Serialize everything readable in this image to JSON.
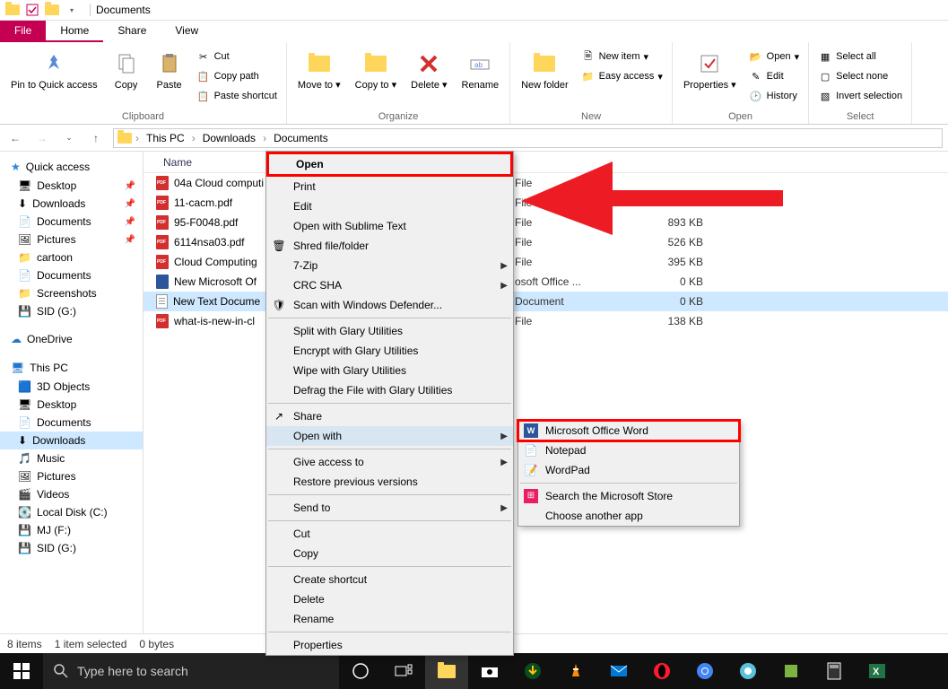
{
  "titlebar": {
    "title": "Documents"
  },
  "tabs": {
    "file": "File",
    "home": "Home",
    "share": "Share",
    "view": "View"
  },
  "ribbon": {
    "clipboard": {
      "label": "Clipboard",
      "pin": "Pin to Quick access",
      "copy": "Copy",
      "paste": "Paste",
      "cut": "Cut",
      "copy_path": "Copy path",
      "paste_shortcut": "Paste shortcut"
    },
    "organize": {
      "label": "Organize",
      "move_to": "Move to",
      "copy_to": "Copy to",
      "delete": "Delete",
      "rename": "Rename"
    },
    "new": {
      "label": "New",
      "new_folder": "New folder",
      "new_item": "New item",
      "easy_access": "Easy access"
    },
    "open": {
      "label": "Open",
      "properties": "Properties",
      "open": "Open",
      "edit": "Edit",
      "history": "History"
    },
    "select": {
      "label": "Select",
      "select_all": "Select all",
      "select_none": "Select none",
      "invert": "Invert selection"
    }
  },
  "breadcrumbs": [
    "This PC",
    "Downloads",
    "Documents"
  ],
  "sidebar": {
    "quick_access": "Quick access",
    "quick_items": [
      {
        "label": "Desktop",
        "pinned": true
      },
      {
        "label": "Downloads",
        "pinned": true
      },
      {
        "label": "Documents",
        "pinned": true
      },
      {
        "label": "Pictures",
        "pinned": true
      },
      {
        "label": "cartoon",
        "pinned": false
      },
      {
        "label": "Documents",
        "pinned": false
      },
      {
        "label": "Screenshots",
        "pinned": false
      },
      {
        "label": "SID (G:)",
        "pinned": false
      }
    ],
    "onedrive": "OneDrive",
    "this_pc": "This PC",
    "pc_items": [
      "3D Objects",
      "Desktop",
      "Documents",
      "Downloads",
      "Music",
      "Pictures",
      "Videos",
      "Local Disk (C:)",
      "MJ (F:)",
      "SID (G:)"
    ]
  },
  "columns": {
    "name": "Name",
    "type": "",
    "size": ""
  },
  "files": [
    {
      "name": "04a Cloud computi",
      "type": "File",
      "size": "",
      "icon": "pdf"
    },
    {
      "name": "11-cacm.pdf",
      "type": "File",
      "size": "",
      "icon": "pdf"
    },
    {
      "name": "95-F0048.pdf",
      "type": "File",
      "size": "893 KB",
      "icon": "pdf"
    },
    {
      "name": "6114nsa03.pdf",
      "type": "File",
      "size": "526 KB",
      "icon": "pdf"
    },
    {
      "name": "Cloud Computing",
      "type": "File",
      "size": "395 KB",
      "icon": "pdf"
    },
    {
      "name": "New Microsoft Of",
      "type": "osoft Office ...",
      "size": "0 KB",
      "icon": "doc"
    },
    {
      "name": "New Text Docume",
      "type": "Document",
      "size": "0 KB",
      "icon": "txt",
      "selected": true
    },
    {
      "name": "what-is-new-in-cl",
      "type": "File",
      "size": "138 KB",
      "icon": "pdf"
    }
  ],
  "status": {
    "items": "8 items",
    "selected": "1 item selected",
    "bytes": "0 bytes"
  },
  "context_menu": [
    {
      "label": "Open",
      "bold": true,
      "highlight": true
    },
    {
      "label": "Print"
    },
    {
      "label": "Edit"
    },
    {
      "label": "Open with Sublime Text"
    },
    {
      "label": "Shred file/folder",
      "icon": "shred"
    },
    {
      "label": "7-Zip",
      "sub": true
    },
    {
      "label": "CRC SHA",
      "sub": true
    },
    {
      "label": "Scan with Windows Defender...",
      "icon": "defender"
    },
    {
      "sep": true
    },
    {
      "label": "Split with Glary Utilities"
    },
    {
      "label": "Encrypt with Glary Utilities"
    },
    {
      "label": "Wipe with Glary Utilities"
    },
    {
      "label": "Defrag the File with Glary Utilities"
    },
    {
      "sep": true
    },
    {
      "label": "Share",
      "icon": "share"
    },
    {
      "label": "Open with",
      "sub": true,
      "hover": true
    },
    {
      "sep": true
    },
    {
      "label": "Give access to",
      "sub": true
    },
    {
      "label": "Restore previous versions"
    },
    {
      "sep": true
    },
    {
      "label": "Send to",
      "sub": true
    },
    {
      "sep": true
    },
    {
      "label": "Cut"
    },
    {
      "label": "Copy"
    },
    {
      "sep": true
    },
    {
      "label": "Create shortcut"
    },
    {
      "label": "Delete"
    },
    {
      "label": "Rename"
    },
    {
      "sep": true
    },
    {
      "label": "Properties"
    }
  ],
  "submenu": [
    {
      "label": "Microsoft Office Word",
      "icon": "word",
      "highlight": true
    },
    {
      "label": "Notepad",
      "icon": "notepad"
    },
    {
      "label": "WordPad",
      "icon": "wordpad"
    },
    {
      "sep": true
    },
    {
      "label": "Search the Microsoft Store",
      "icon": "store"
    },
    {
      "label": "Choose another app"
    }
  ],
  "taskbar": {
    "search_placeholder": "Type here to search"
  }
}
